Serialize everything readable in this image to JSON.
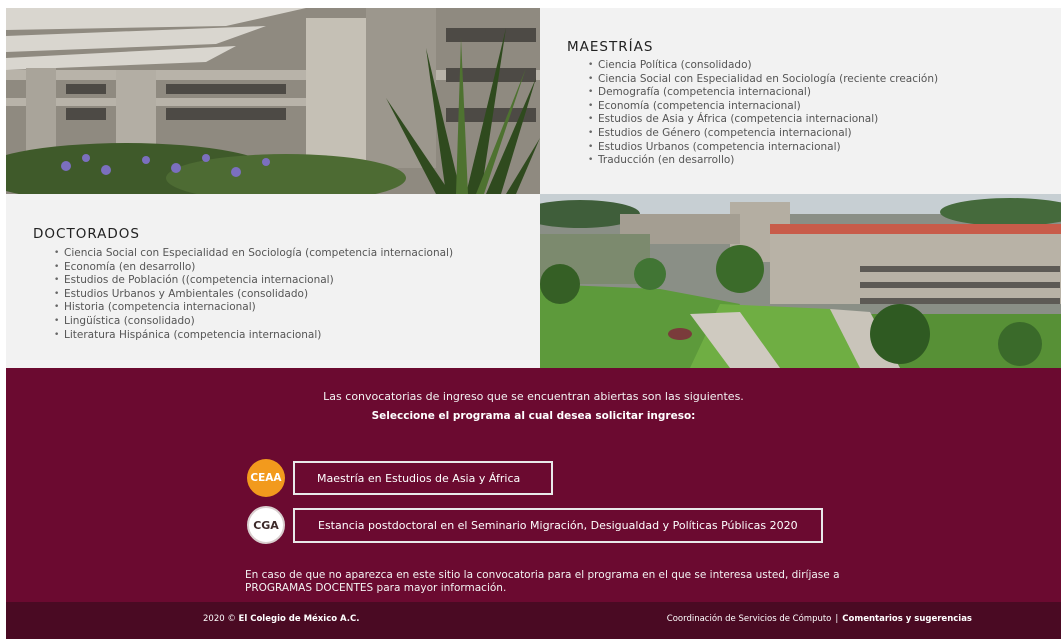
{
  "maestrias": {
    "title": "MAESTRÍAS",
    "items": [
      "Ciencia Política (consolidado)",
      "Ciencia Social con Especialidad en Sociología (reciente creación)",
      "Demografía (competencia internacional)",
      "Economía (competencia internacional)",
      "Estudios de Asia y África (competencia internacional)",
      "Estudios de Género (competencia internacional)",
      "Estudios Urbanos (competencia internacional)",
      "Traducción (en desarrollo)"
    ]
  },
  "doctorados": {
    "title": "DOCTORADOS",
    "items": [
      "Ciencia Social con Especialidad en Sociología (competencia internacional)",
      "Economía (en desarrollo)",
      "Estudios de Población ((competencia internacional)",
      "Estudios Urbanos y Ambientales (consolidado)",
      "Historia (competencia internacional)",
      "Lingüística (consolidado)",
      "Literatura Hispánica (competencia internacional)"
    ]
  },
  "convocatorias": {
    "intro": "Las convocatorias de ingreso que se encuentran abiertas son las siguientes.",
    "instruction": "Seleccione el programa al cual desea solicitar ingreso:",
    "programs": [
      {
        "badge": "CEAA",
        "label": "Maestría en Estudios de Asia y África"
      },
      {
        "badge": "CGA",
        "label": "Estancia postdoctoral en el Seminario Migración, Desigualdad y Políticas Públicas 2020"
      }
    ],
    "notice": "En caso de que no aparezca en este sitio la convocatoria para el programa en el que se interesa usted, diríjase a PROGRAMAS DOCENTES para mayor información."
  },
  "footer": {
    "year": "2020 ©",
    "org": "El Colegio de México A.C.",
    "coord": "Coordinación de Servicios de Cómputo",
    "separator": "|",
    "feedback": "Comentarios y sugerencias"
  },
  "colors": {
    "maroon": "#6b0a30",
    "footer": "#4a0a23",
    "ceaa_orange": "#f29a1d"
  },
  "icons": [
    "ceaa-logo-icon",
    "cga-logo-icon"
  ]
}
